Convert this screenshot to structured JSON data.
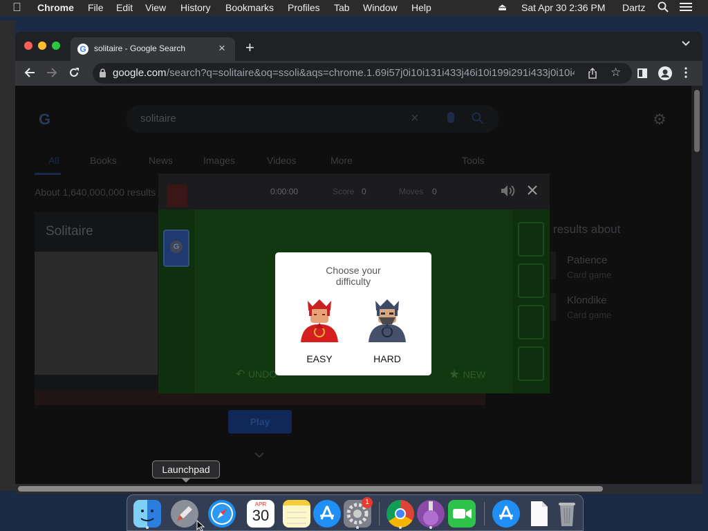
{
  "menubar": {
    "apple": "",
    "app": "Chrome",
    "items": [
      "File",
      "Edit",
      "View",
      "History",
      "Bookmarks",
      "Profiles",
      "Tab",
      "Window",
      "Help"
    ],
    "clock": "Sat Apr 30  2:36 PM",
    "user": "Dartz"
  },
  "browser": {
    "tab_title": "solitaire - Google Search",
    "url_host": "google.com",
    "url_rest": "/search?q=solitaire&oq=ssoli&aqs=chrome.1.69i57j0i10i131i433j46i10i199i291i433j0i10i4..."
  },
  "search": {
    "query": "solitaire",
    "tabs": [
      "All",
      "Books",
      "News",
      "Images",
      "Videos",
      "More"
    ],
    "tools": "Tools",
    "result_count": "About 1,640,000,000 results",
    "card_title": "Solitaire",
    "play": "Play",
    "side_header": "results about",
    "side_items": [
      {
        "title": "Patience",
        "subtitle": "Card game"
      },
      {
        "title": "Klondike",
        "subtitle": "Card game"
      }
    ]
  },
  "game": {
    "timer": "0:00:00",
    "score_label": "Score",
    "score": "0",
    "moves_label": "Moves",
    "moves": "0",
    "undo": "UNDO",
    "new": "NEW",
    "dialog": {
      "title": "Choose your difficulty",
      "easy": "EASY",
      "hard": "HARD"
    }
  },
  "dock": {
    "tooltip": "Launchpad",
    "calendar_month": "APR",
    "calendar_day": "30",
    "badge": "1"
  },
  "colors": {
    "felt": "#1e5e1e",
    "chrome_bg": "#202124",
    "accent_blue": "#1a73e8"
  }
}
